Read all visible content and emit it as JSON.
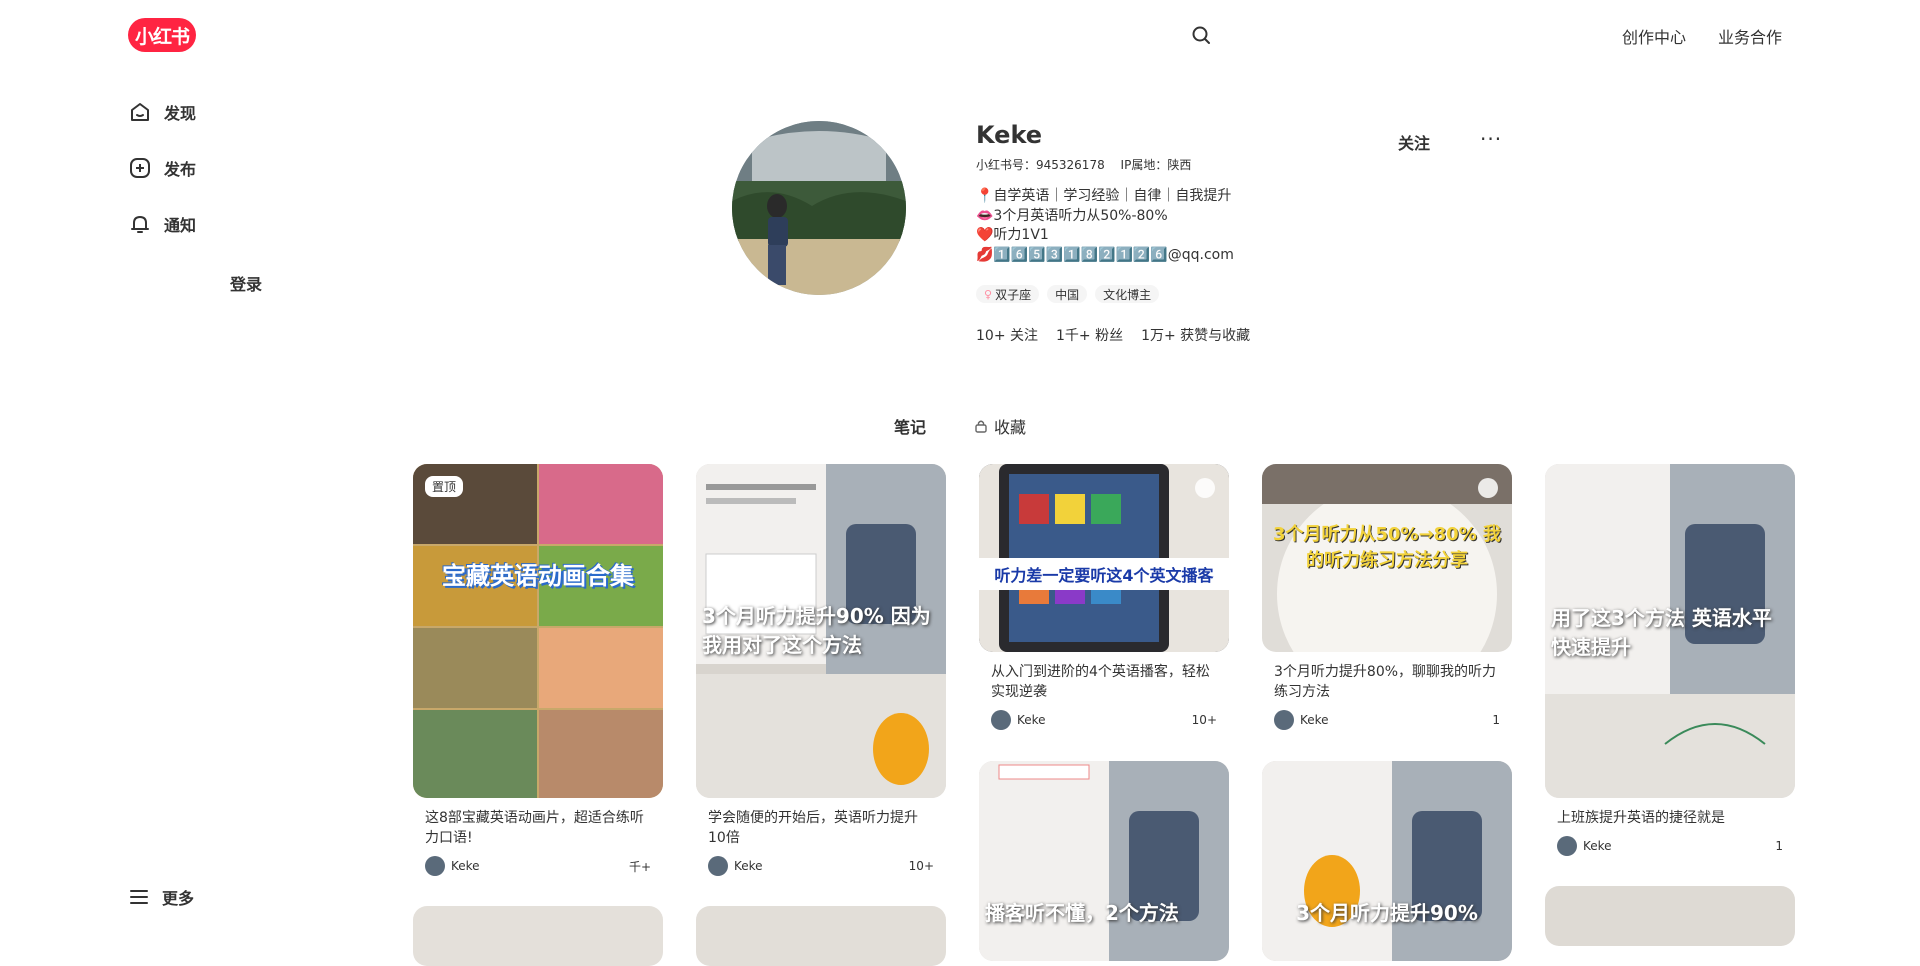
{
  "header": {
    "logo": "小红书",
    "links": [
      "创作中心",
      "业务合作"
    ]
  },
  "sidebar": {
    "items": [
      {
        "label": "发现",
        "icon": "home-icon"
      },
      {
        "label": "发布",
        "icon": "plus-icon"
      },
      {
        "label": "通知",
        "icon": "bell-icon"
      }
    ],
    "login": "登录",
    "more": "更多"
  },
  "profile": {
    "name": "Keke",
    "id_label": "小红书号：945326178",
    "ip_label": "IP属地：陕西",
    "follow": "关注",
    "more": "···",
    "bio": [
      "📍自学英语｜学习经验｜自律｜自我提升",
      "👄3个月英语听力从50%-80%",
      "❤️听力1V1",
      "💋1️⃣6️⃣5️⃣3️⃣1️⃣8️⃣2️⃣1️⃣2️⃣6️⃣@qq.com"
    ],
    "tags": [
      "双子座",
      "中国",
      "文化博主"
    ],
    "stats": [
      "10+ 关注",
      "1千+ 粉丝",
      "1万+ 获赞与收藏"
    ]
  },
  "tabs": [
    "笔记",
    "收藏"
  ],
  "notes": [
    {
      "title": "这8部宝藏英语动画片，超适合练听力口语!",
      "author": "Keke",
      "likes": "千+",
      "badge": "置顶",
      "cover_text": "宝藏英语动画合集",
      "cover_color": "#c8a86a"
    },
    {
      "title": "学会随便的开始后，英语听力提升10倍",
      "author": "Keke",
      "likes": "10+",
      "cover_text": "3个月听力提升90% 因为我用对了这个方法",
      "cover_color": "#d8d4ce"
    },
    {
      "title": "从入门到进阶的4个英语播客，轻松实现逆袭",
      "author": "Keke",
      "likes": "10+",
      "cover_text": "听力差一定要听这4个英文播客",
      "cover_color": "#4a4a52"
    },
    {
      "title": "3个月听力提升80%，聊聊我的听力练习方法",
      "author": "Keke",
      "likes": "1",
      "cover_text": "3个月听力从50%→80% 我的听力练习方法分享",
      "cover_color": "#e0ddd8"
    },
    {
      "title": "上班族提升英语的捷径就是",
      "author": "Keke",
      "likes": "1",
      "cover_text": "用了这3个方法 英语水平快速提升",
      "cover_color": "#d6d3cf"
    },
    {
      "cover_text": "播客听不懂，2个方法",
      "cover_color": "#dad7d2"
    },
    {
      "cover_text": "3个月听力提升90%",
      "cover_color": "#d5d2cd"
    },
    {
      "cover_text": "",
      "cover_color": "#e4e0da"
    },
    {
      "cover_text": "",
      "cover_color": "#e2ded8"
    },
    {
      "cover_text": "",
      "cover_color": "#dedad4"
    }
  ]
}
